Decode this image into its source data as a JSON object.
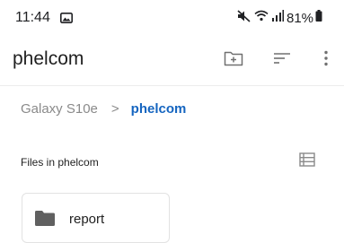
{
  "status_bar": {
    "time": "11:44",
    "battery_percent": "81%",
    "icons": [
      "image-notification-icon",
      "mute-icon",
      "wifi-icon",
      "signal-icon",
      "battery-icon"
    ]
  },
  "app_bar": {
    "title": "phelcom",
    "actions": [
      "new-folder-icon",
      "sort-icon",
      "more-vert-icon"
    ]
  },
  "breadcrumb": {
    "root": "Galaxy S10e",
    "separator": ">",
    "current": "phelcom"
  },
  "section": {
    "label": "Files in phelcom",
    "view_toggle_icon": "list-view-icon"
  },
  "items": [
    {
      "type": "folder",
      "name": "report",
      "icon": "folder-icon"
    }
  ],
  "colors": {
    "accent": "#1565c0",
    "muted": "#8a8a8a",
    "icon_gray": "#707070"
  }
}
